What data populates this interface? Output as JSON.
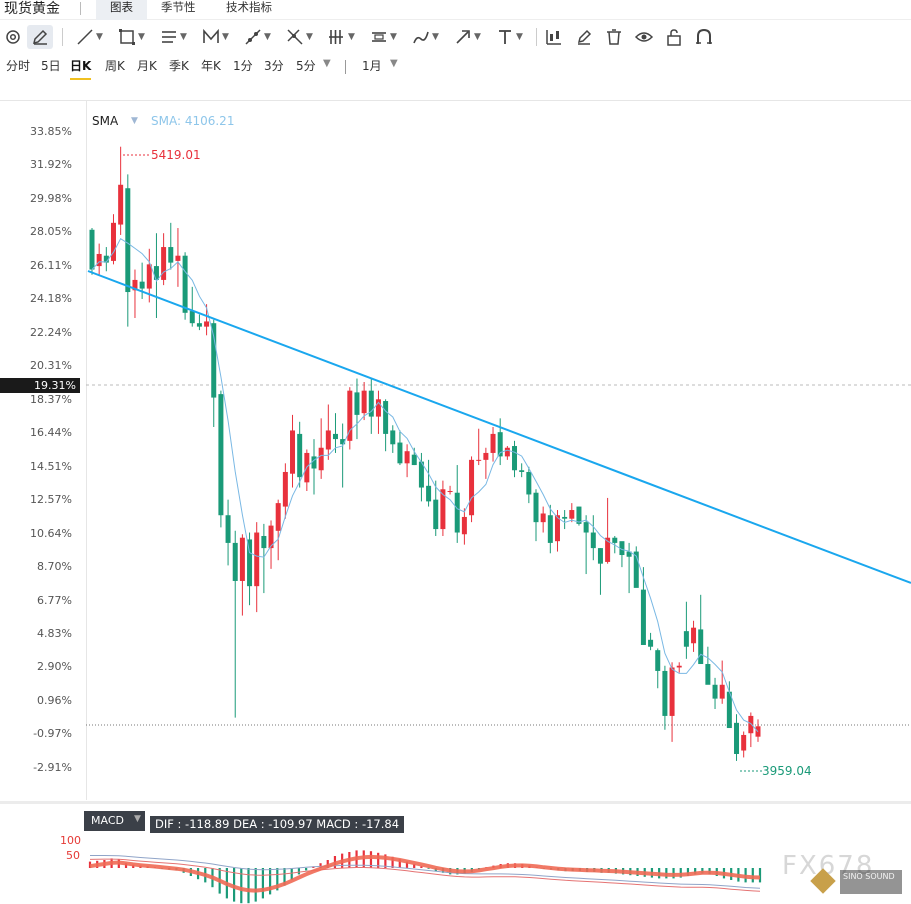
{
  "app": {
    "title": "现货黄金"
  },
  "tabs": [
    {
      "label": "图表",
      "active": true
    },
    {
      "label": "季节性",
      "active": false
    },
    {
      "label": "技术指标",
      "active": false
    }
  ],
  "toolbar_icons": [
    "settings-icon",
    "pencil-icon",
    "line-icon",
    "rectangle-icon",
    "horizontal-lines-icon",
    "pattern-icon",
    "ray-icon",
    "cross-tool-icon",
    "vertical-lines-icon",
    "channel-icon",
    "brush-icon",
    "arrow-icon",
    "text-icon",
    "candle-icon",
    "edit-icon",
    "trash-icon",
    "eye-icon",
    "unlock-icon",
    "magnet-icon"
  ],
  "periods": [
    {
      "label": "分时"
    },
    {
      "label": "5日"
    },
    {
      "label": "日K",
      "active": true
    },
    {
      "label": "周K"
    },
    {
      "label": "月K"
    },
    {
      "label": "季K"
    },
    {
      "label": "年K"
    },
    {
      "label": "1分"
    },
    {
      "label": "3分"
    },
    {
      "label": "5分"
    }
  ],
  "range_label": "1月",
  "sma": {
    "label": "SMA",
    "value_text": "SMA: 4106.21"
  },
  "y_axis": {
    "ticks": [
      "33.85%",
      "31.92%",
      "29.98%",
      "28.05%",
      "26.11%",
      "24.18%",
      "22.24%",
      "20.31%",
      "18.37%",
      "16.44%",
      "14.51%",
      "12.57%",
      "10.64%",
      "8.70%",
      "6.77%",
      "4.83%",
      "2.90%",
      "0.96%",
      "-0.97%",
      "-2.91%"
    ],
    "current": "19.31%"
  },
  "levels": {
    "high": "5419.01",
    "low": "3959.04"
  },
  "macd": {
    "label": "MACD",
    "values_text": "DIF : -118.89   DEA : -109.97   MACD : -17.84",
    "axis": [
      "100",
      "50"
    ]
  },
  "watermark": {
    "brand": "FX678",
    "sub": "SINO SOUND"
  },
  "colors": {
    "up": "#e8313c",
    "down": "#1a9a78",
    "trend": "#1aa7ee",
    "sma": "#79b8e4",
    "macd_line": "#f06a55"
  },
  "chart_data": {
    "type": "candlestick",
    "pct_range": [
      -2.91,
      33.85
    ],
    "price_range": [
      3959.04,
      5419.01
    ],
    "last_price": 4106.21,
    "candles_pct": [
      [
        28.2,
        28.3,
        25.6,
        25.9
      ],
      [
        26.1,
        27.4,
        25.6,
        26.8
      ],
      [
        26.7,
        27.2,
        25.8,
        26.3
      ],
      [
        26.4,
        29.1,
        26.2,
        28.6
      ],
      [
        28.5,
        33.0,
        27.9,
        30.8
      ],
      [
        30.6,
        31.4,
        22.6,
        24.6
      ],
      [
        24.7,
        25.9,
        23.1,
        25.3
      ],
      [
        25.2,
        26.3,
        24.2,
        24.8
      ],
      [
        24.8,
        27.1,
        24.0,
        26.2
      ],
      [
        26.1,
        28.0,
        23.1,
        25.3
      ],
      [
        25.3,
        28.0,
        25.0,
        27.2
      ],
      [
        27.2,
        28.6,
        25.9,
        26.3
      ],
      [
        26.4,
        28.3,
        24.9,
        26.7
      ],
      [
        26.7,
        26.9,
        23.0,
        23.4
      ],
      [
        23.5,
        24.9,
        22.6,
        22.8
      ],
      [
        22.8,
        23.3,
        22.4,
        22.6
      ],
      [
        22.6,
        23.9,
        22.1,
        22.9
      ],
      [
        22.8,
        23.0,
        16.8,
        18.5
      ],
      [
        18.7,
        18.9,
        11.0,
        11.7
      ],
      [
        11.7,
        12.6,
        8.8,
        10.1
      ],
      [
        10.1,
        10.8,
        0.0,
        7.9
      ],
      [
        7.9,
        10.6,
        5.9,
        10.4
      ],
      [
        10.3,
        10.7,
        6.5,
        7.6
      ],
      [
        7.6,
        11.3,
        6.1,
        10.7
      ],
      [
        10.5,
        11.2,
        7.2,
        9.8
      ],
      [
        9.8,
        11.4,
        8.6,
        11.1
      ],
      [
        10.8,
        12.6,
        9.1,
        12.4
      ],
      [
        12.2,
        14.7,
        11.5,
        14.2
      ],
      [
        14.1,
        17.5,
        13.3,
        16.6
      ],
      [
        16.4,
        17.1,
        13.3,
        13.9
      ],
      [
        13.6,
        15.5,
        13.1,
        15.3
      ],
      [
        15.1,
        16.1,
        12.9,
        14.4
      ],
      [
        14.3,
        17.3,
        13.8,
        15.6
      ],
      [
        15.5,
        18.1,
        14.9,
        16.6
      ],
      [
        16.4,
        17.6,
        15.3,
        16.1
      ],
      [
        16.1,
        17.0,
        13.3,
        15.8
      ],
      [
        16.0,
        19.1,
        15.5,
        18.9
      ],
      [
        18.8,
        19.6,
        16.1,
        17.5
      ],
      [
        17.6,
        19.4,
        17.2,
        18.9
      ],
      [
        18.9,
        19.6,
        16.4,
        17.4
      ],
      [
        17.4,
        18.9,
        16.4,
        18.4
      ],
      [
        18.3,
        18.4,
        15.4,
        16.4
      ],
      [
        16.6,
        16.9,
        15.3,
        15.8
      ],
      [
        15.9,
        16.6,
        14.6,
        14.7
      ],
      [
        14.7,
        15.8,
        13.9,
        15.4
      ],
      [
        15.2,
        15.6,
        14.6,
        14.6
      ],
      [
        14.8,
        15.3,
        12.5,
        13.3
      ],
      [
        13.4,
        14.9,
        12.2,
        12.5
      ],
      [
        12.6,
        13.7,
        10.5,
        10.9
      ],
      [
        10.9,
        13.7,
        10.5,
        13.2
      ],
      [
        13.1,
        13.4,
        12.9,
        13.1
      ],
      [
        13.0,
        14.6,
        10.1,
        10.7
      ],
      [
        10.6,
        12.1,
        10.0,
        11.6
      ],
      [
        11.7,
        15.1,
        11.3,
        14.9
      ],
      [
        14.9,
        16.7,
        14.6,
        14.9
      ],
      [
        14.9,
        15.6,
        13.8,
        15.3
      ],
      [
        15.3,
        16.8,
        14.8,
        16.4
      ],
      [
        16.5,
        17.3,
        14.6,
        15.1
      ],
      [
        15.1,
        15.7,
        14.9,
        15.6
      ],
      [
        15.7,
        16.0,
        13.9,
        14.3
      ],
      [
        14.3,
        14.7,
        13.9,
        14.2
      ],
      [
        14.2,
        14.5,
        12.4,
        12.9
      ],
      [
        13.0,
        13.2,
        10.2,
        11.3
      ],
      [
        11.3,
        12.2,
        10.7,
        11.8
      ],
      [
        11.7,
        12.3,
        9.5,
        10.1
      ],
      [
        10.2,
        12.0,
        9.6,
        11.7
      ],
      [
        11.6,
        12.0,
        10.9,
        11.5
      ],
      [
        11.5,
        12.4,
        11.3,
        12.0
      ],
      [
        12.2,
        12.2,
        11.1,
        11.2
      ],
      [
        11.3,
        11.7,
        8.3,
        10.7
      ],
      [
        10.7,
        11.7,
        9.1,
        9.8
      ],
      [
        9.8,
        9.8,
        7.1,
        8.9
      ],
      [
        9.0,
        12.7,
        8.9,
        10.4
      ],
      [
        10.4,
        10.5,
        9.5,
        10.1
      ],
      [
        10.2,
        10.1,
        8.7,
        9.4
      ],
      [
        9.6,
        10.1,
        7.2,
        9.3
      ],
      [
        9.6,
        9.9,
        8.1,
        7.5
      ],
      [
        7.4,
        8.7,
        4.4,
        4.2
      ],
      [
        4.5,
        4.9,
        3.9,
        4.1
      ],
      [
        3.9,
        4.0,
        1.7,
        2.7
      ],
      [
        2.7,
        3.0,
        -0.7,
        0.1
      ],
      [
        0.1,
        3.2,
        -1.4,
        2.9
      ],
      [
        2.9,
        3.2,
        2.6,
        3.0
      ],
      [
        5.0,
        6.7,
        3.4,
        4.1
      ],
      [
        4.3,
        5.6,
        3.8,
        5.2
      ],
      [
        5.1,
        7.1,
        4.7,
        3.1
      ],
      [
        3.1,
        4.1,
        2.9,
        1.9
      ],
      [
        1.9,
        2.3,
        0.5,
        1.1
      ],
      [
        1.1,
        3.3,
        0.8,
        1.9
      ],
      [
        1.5,
        2.1,
        0.4,
        -0.6
      ],
      [
        -0.3,
        0.2,
        -2.5,
        -2.1
      ],
      [
        -1.9,
        -0.8,
        -2.3,
        -1.0
      ],
      [
        -0.9,
        0.3,
        -1.7,
        0.1
      ],
      [
        -1.1,
        -0.1,
        -1.4,
        -0.5
      ]
    ],
    "macd_hist": [
      8,
      9,
      10,
      12,
      11,
      6,
      4,
      3,
      2,
      1,
      -1,
      -2,
      -3,
      -6,
      -10,
      -14,
      -18,
      -24,
      -32,
      -38,
      -42,
      -44,
      -44,
      -42,
      -38,
      -33,
      -28,
      -22,
      -15,
      -8,
      -3,
      2,
      6,
      10,
      15,
      18,
      20,
      22,
      22,
      21,
      19,
      17,
      14,
      11,
      8,
      5,
      2,
      -1,
      -4,
      -6,
      -8,
      -8,
      -7,
      -5,
      -2,
      1,
      3,
      5,
      6,
      6,
      5,
      3,
      1,
      -1,
      -2,
      -3,
      -4,
      -4,
      -4,
      -5,
      -5,
      -6,
      -6,
      -7,
      -8,
      -9,
      -10,
      -11,
      -12,
      -13,
      -13,
      -13,
      -12,
      -10,
      -8,
      -7,
      -8,
      -10,
      -13,
      -15,
      -17,
      -18,
      -18,
      -18
    ],
    "macd_axis": [
      100,
      50
    ]
  }
}
